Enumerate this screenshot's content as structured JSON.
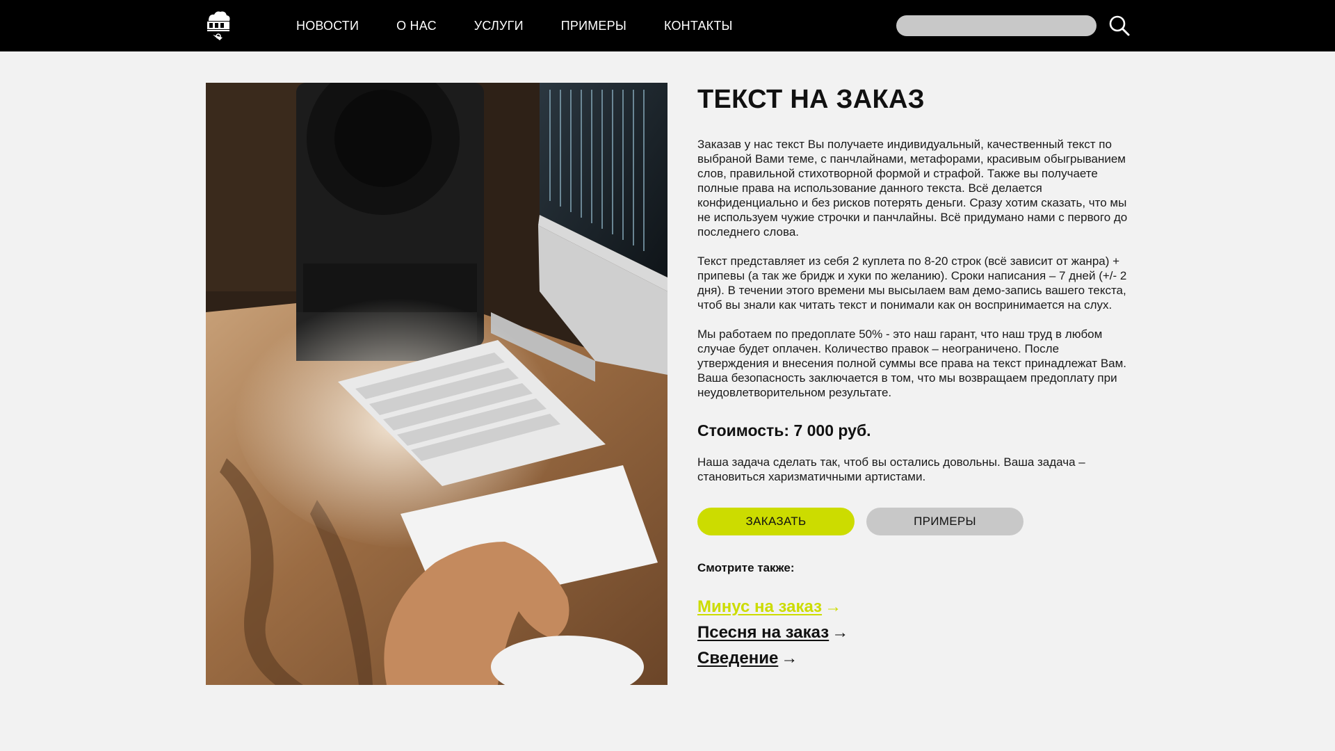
{
  "nav": {
    "items": [
      {
        "label": "НОВОСТИ"
      },
      {
        "label": "О НАС"
      },
      {
        "label": "УСЛУГИ"
      },
      {
        "label": "ПРИМЕРЫ"
      },
      {
        "label": "КОНТАКТЫ"
      }
    ],
    "search": {
      "placeholder": "",
      "value": ""
    },
    "search_icon": "search-icon"
  },
  "page": {
    "title": "ТЕКСТ НА ЗАКАЗ",
    "paragraphs": [
      "Заказав у нас текст Вы получаете индивидуальный, качественный текст по выбраной Вами теме, с панчлайнами, метафорами, красивым обыгрыванием слов, правильной стихотворной формой и страфой. Также вы получаете полные права на использование данного текста. Всё делается конфиденциально и без рисков потерять деньги. Сразу хотим сказать, что мы не используем чужие строчки и панчлайны. Всё придумано нами с первого до последнего слова.",
      "Текст представляет из себя 2 куплета по 8-20 строк (всё зависит от жанра) + припевы (а так же бридж и хуки по желанию). Сроки написания – 7 дней (+/- 2 дня). В течении этого времени мы высылаем вам демо-запись вашего текста, чтоб вы знали как читать текст и понимали как он воспринимается на слух.",
      "Мы работаем по предоплате 50% - это наш гарант, что наш труд в любом случае будет оплачен. Количество правок – неограничено. После утверждения и внесения полной суммы все права на текст принадлежат Вам. Ваша безопасность заключается в том, что мы возвращаем предоплату при неудовлетворительном результате."
    ],
    "price": "Стоимость: 7 000 руб.",
    "closing": "Наша задача сделать так, чтоб вы остались довольны. Ваша задача – становиться харизматичными артистами.",
    "buttons": {
      "order": "ЗАКАЗАТЬ",
      "examples": "ПРИМЕРЫ"
    },
    "see_also_label": "Смотрите также:",
    "see_also": [
      {
        "label": "Минус на заказ",
        "arrow": "→",
        "active": true
      },
      {
        "label": "Псесня на заказ",
        "arrow": "→",
        "active": false
      },
      {
        "label": "Сведение",
        "arrow": "→",
        "active": false
      }
    ]
  },
  "colors": {
    "accent": "#ccdc00",
    "nav_bg": "#000000",
    "page_bg": "#f2f2f2",
    "button_secondary": "#c8c8c8"
  }
}
